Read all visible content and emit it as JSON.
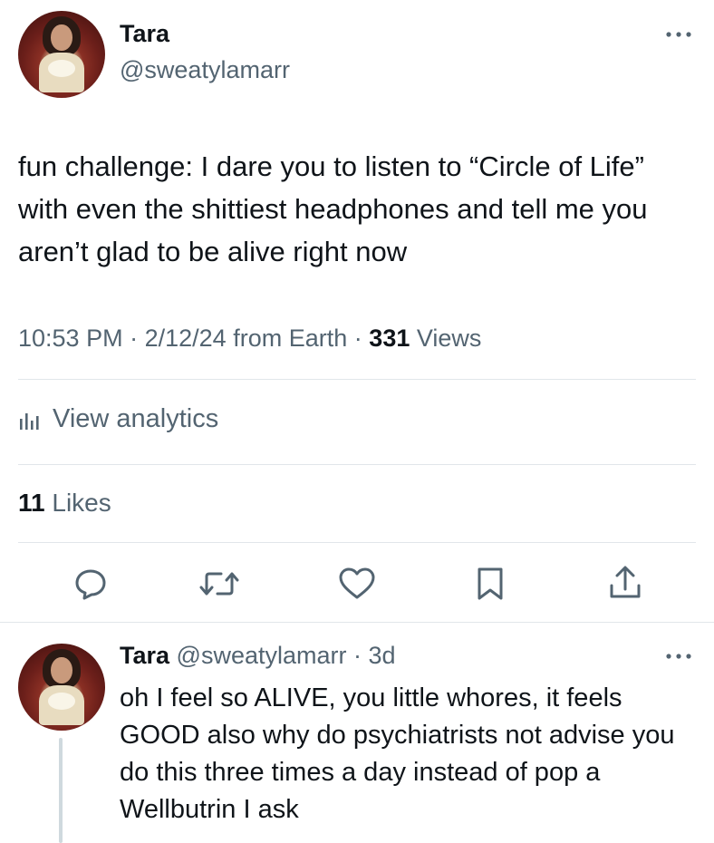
{
  "tweet": {
    "author_name": "Tara",
    "author_handle": "@sweatylamarr",
    "text": "fun challenge: I dare you to listen to “Circle of Life” with even the shittiest headphones and tell me you aren’t glad to be alive right now",
    "time": "10:53 PM",
    "date": "2/12/24",
    "source": "from Earth",
    "views_count": "331",
    "views_label": "Views",
    "separator": "·"
  },
  "analytics": {
    "label": "View analytics"
  },
  "likes": {
    "count": "11",
    "label": "Likes"
  },
  "actions": [
    "reply",
    "retweet",
    "like",
    "bookmark",
    "share"
  ],
  "reply": {
    "author_name": "Tara",
    "author_handle": "@sweatylamarr",
    "age": "3d",
    "separator": "·",
    "text": "oh I feel so ALIVE, you little whores, it feels GOOD also why do psychiatrists not advise you do this three times a day instead of pop a Wellbutrin I ask"
  },
  "colors": {
    "text_primary": "#0f1419",
    "text_secondary": "#536471",
    "divider": "#e1e6ea",
    "thread_line": "#cfd9de"
  }
}
